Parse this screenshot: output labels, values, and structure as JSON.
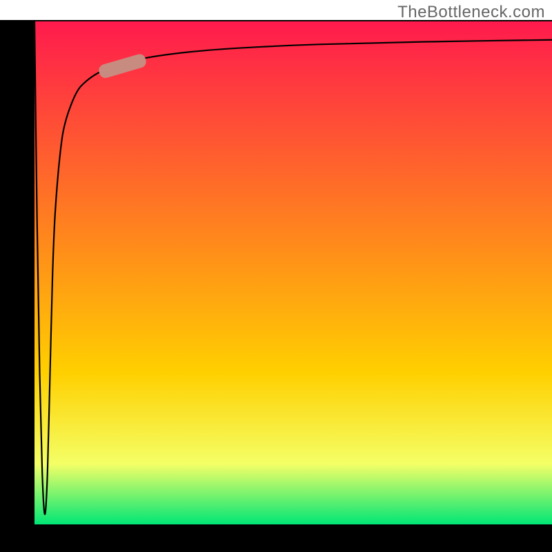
{
  "watermark": "TheBottleneck.com",
  "chart_data": {
    "type": "line",
    "title": "",
    "xlabel": "",
    "ylabel": "",
    "xlim": [
      0,
      100
    ],
    "ylim": [
      0,
      100
    ],
    "grid": false,
    "legend": false,
    "background_gradient": {
      "top": "#ff1a4d",
      "mid": "#ffd000",
      "bottom": "#00e676"
    },
    "series": [
      {
        "name": "primary-curve",
        "x": [
          0.0,
          0.5,
          1.0,
          1.5,
          2.0,
          2.5,
          3.0,
          3.5,
          4.0,
          5.0,
          6.0,
          8.0,
          10.0,
          13.0,
          17.0,
          22.0,
          30.0,
          40.0,
          55.0,
          75.0,
          100.0
        ],
        "y": [
          100.0,
          60.0,
          30.0,
          10.0,
          2.0,
          10.0,
          30.0,
          50.0,
          62.0,
          74.0,
          80.0,
          85.5,
          88.0,
          90.0,
          91.5,
          92.7,
          93.8,
          94.6,
          95.3,
          95.8,
          96.2
        ]
      }
    ],
    "highlight_marker": {
      "series": "primary-curve",
      "x_center": 17.0,
      "y_center": 91.0,
      "color": "#c88b80",
      "shape": "rounded-bar"
    },
    "frame_color": "#000000",
    "frame_right_open": true
  }
}
